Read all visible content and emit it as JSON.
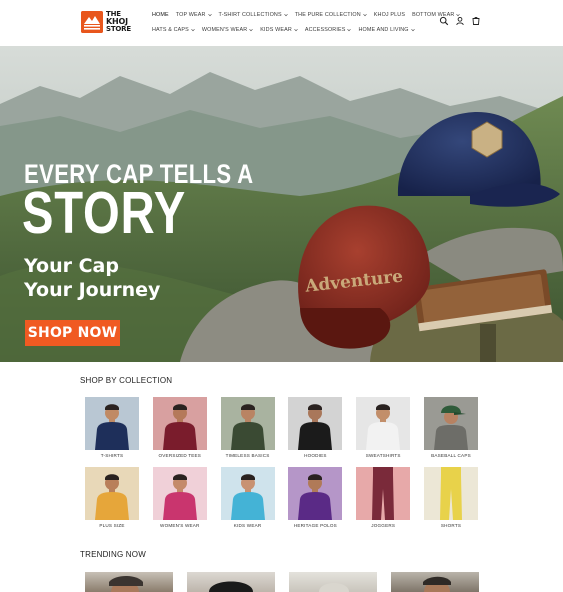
{
  "brand": {
    "logo_text_line1": "THE",
    "logo_text_line2": "KHOJ",
    "logo_text_line3": "STORE",
    "accent": "#e8561c"
  },
  "nav": {
    "row1": [
      {
        "label": "HOME",
        "dropdown": false
      },
      {
        "label": "TOP WEAR",
        "dropdown": true
      },
      {
        "label": "T-SHIRT COLLECTIONS",
        "dropdown": true
      },
      {
        "label": "THE PURE COLLECTION",
        "dropdown": true
      },
      {
        "label": "KHOJ PLUS",
        "dropdown": false
      },
      {
        "label": "BOTTOM WEAR",
        "dropdown": true
      }
    ],
    "row2": [
      {
        "label": "HATS & CAPS",
        "dropdown": true
      },
      {
        "label": "WOMEN'S WEAR",
        "dropdown": true
      },
      {
        "label": "KIDS WEAR",
        "dropdown": true
      },
      {
        "label": "ACCESSORIES",
        "dropdown": true
      },
      {
        "label": "HOME AND LIVING",
        "dropdown": true
      }
    ],
    "icons": [
      "search-icon",
      "account-icon",
      "cart-icon"
    ]
  },
  "hero": {
    "title_line1": "EVERY CAP TELLS A",
    "title_line2": "STORY",
    "subtitle_line1": "Your Cap",
    "subtitle_line2": "Your Journey",
    "cta": "SHOP NOW",
    "cta_color": "#f05a22",
    "cap_text": "Adventure"
  },
  "collection": {
    "title": "SHOP BY COLLECTION",
    "items": [
      {
        "label": "T-SHIRTS",
        "bg": "#b9c7d3",
        "garment": "#1e2f5a",
        "skin": "#c08a64"
      },
      {
        "label": "OVERSIZED TEES",
        "bg": "#d8a0a0",
        "garment": "#7a1c2c",
        "skin": "#b5795a"
      },
      {
        "label": "TIMELESS BASICS",
        "bg": "#a9b3a0",
        "garment": "#3a4a33",
        "skin": "#b98463"
      },
      {
        "label": "HOODIES",
        "bg": "#d3d3d3",
        "garment": "#1b1b1b",
        "skin": "#a9775a"
      },
      {
        "label": "SWEATSHIRTS",
        "bg": "#e6e6e6",
        "garment": "#f2f2f2",
        "skin": "#c28e6a"
      },
      {
        "label": "BASEBALL CAPS",
        "bg": "#9a9a94",
        "garment": "#2f5b3a",
        "skin": "#b78262"
      },
      {
        "label": "PLUS SIZE",
        "bg": "#e8d8b8",
        "garment": "#e6a63a",
        "skin": "#b97f5a"
      },
      {
        "label": "WOMEN'S WEAR",
        "bg": "#f0d0d8",
        "garment": "#c9356e",
        "skin": "#c48a6a"
      },
      {
        "label": "KIDS WEAR",
        "bg": "#cfe3ec",
        "garment": "#44b3d6",
        "skin": "#c89272"
      },
      {
        "label": "HERITAGE POLOS",
        "bg": "#b596c8",
        "garment": "#5a2a86",
        "skin": "#b07a58"
      },
      {
        "label": "JOGGERS",
        "bg": "#e7a9a9",
        "garment": "#7a2a3a",
        "skin": "#b5795a"
      },
      {
        "label": "SHORTS",
        "bg": "#ece7d6",
        "garment": "#e8d24a",
        "skin": "#c08a64"
      }
    ]
  },
  "trending": {
    "title": "TRENDING NOW"
  }
}
